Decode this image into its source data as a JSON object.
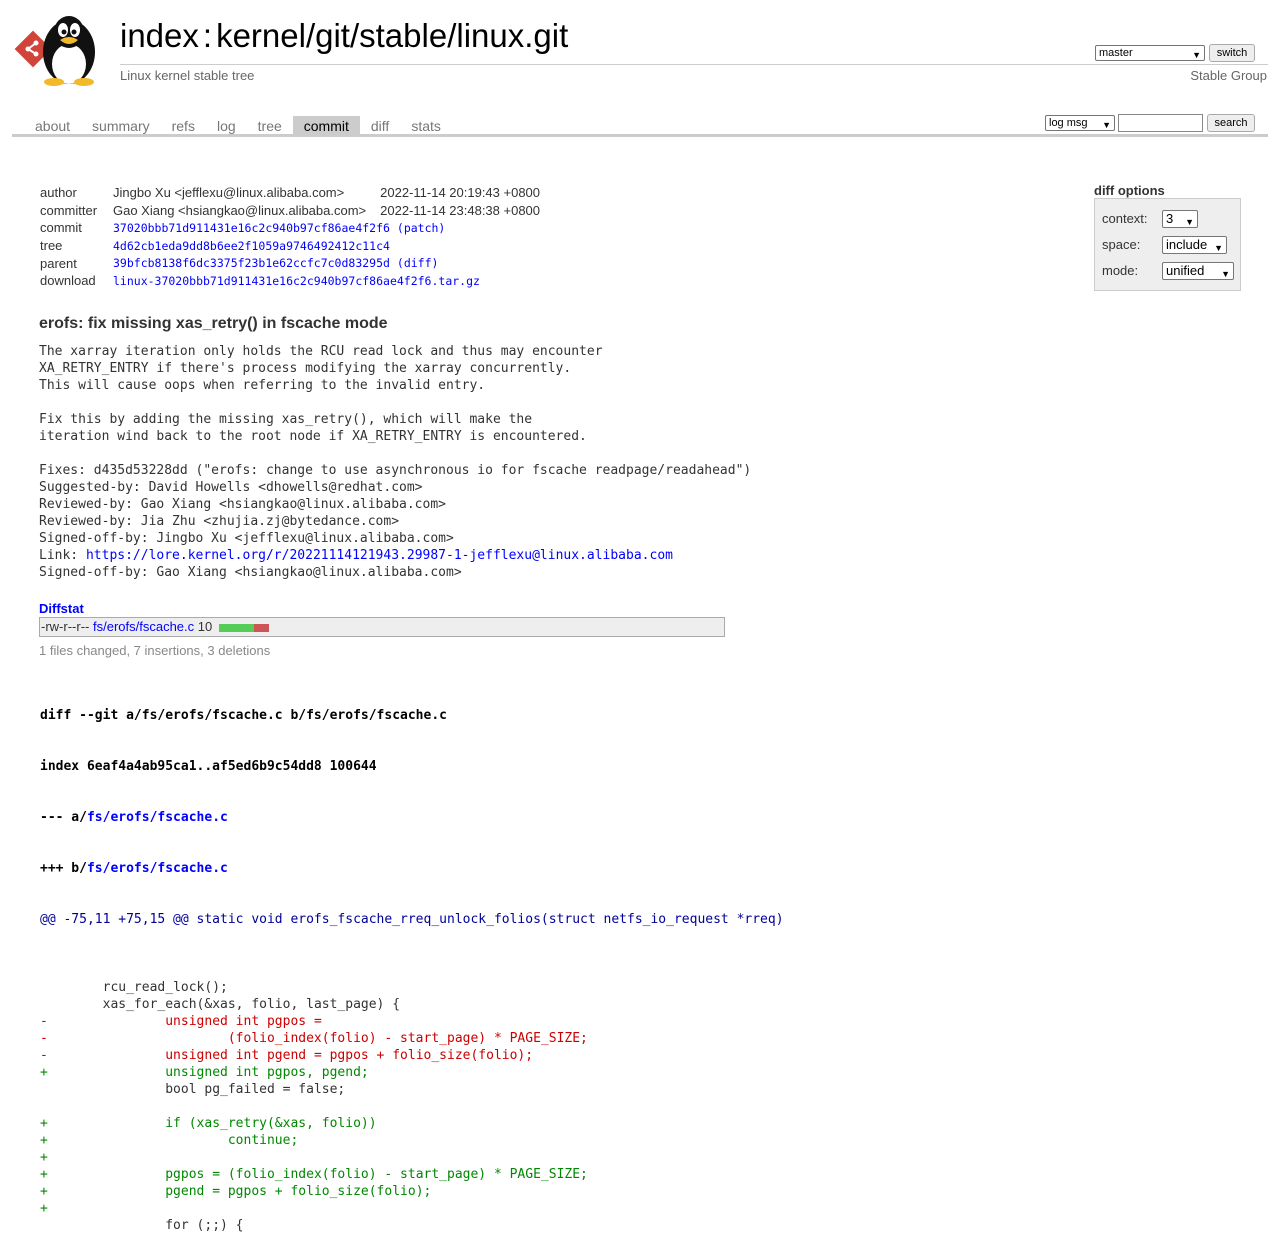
{
  "header": {
    "title_index": "index",
    "title_sep": ":",
    "title_repo": "kernel/git/stable/linux.git",
    "subtitle": "Linux kernel stable tree",
    "branch": "master",
    "switch_label": "switch",
    "owner": "Stable Group"
  },
  "tabs": [
    {
      "label": "about",
      "active": false
    },
    {
      "label": "summary",
      "active": false
    },
    {
      "label": "refs",
      "active": false
    },
    {
      "label": "log",
      "active": false
    },
    {
      "label": "tree",
      "active": false
    },
    {
      "label": "commit",
      "active": true
    },
    {
      "label": "diff",
      "active": false
    },
    {
      "label": "stats",
      "active": false
    }
  ],
  "search": {
    "type": "log msg",
    "value": "",
    "button": "search"
  },
  "diff_options": {
    "title": "diff options",
    "context_label": "context:",
    "context_value": "3",
    "space_label": "space:",
    "space_value": "include",
    "mode_label": "mode:",
    "mode_value": "unified"
  },
  "commit": {
    "author_label": "author",
    "author": "Jingbo Xu <jefflexu@linux.alibaba.com>",
    "author_date": "2022-11-14 20:19:43 +0800",
    "committer_label": "committer",
    "committer": "Gao Xiang <hsiangkao@linux.alibaba.com>",
    "committer_date": "2022-11-14 23:48:38 +0800",
    "commit_label": "commit",
    "commit_hash": "37020bbb71d911431e16c2c940b97cf86ae4f2f6",
    "patch_link": "(patch)",
    "tree_label": "tree",
    "tree_hash": "4d62cb1eda9dd8b6ee2f1059a9746492412c11c4",
    "parent_label": "parent",
    "parent_hash": "39bfcb8138f6dc3375f23b1e62ccfc7c0d83295d",
    "diff_link": "(diff)",
    "download_label": "download",
    "download_file": "linux-37020bbb71d911431e16c2c940b97cf86ae4f2f6.tar.gz"
  },
  "message": {
    "subject": "erofs: fix missing xas_retry() in fscache mode",
    "body": "The xarray iteration only holds the RCU read lock and thus may encounter\nXA_RETRY_ENTRY if there's process modifying the xarray concurrently.\nThis will cause oops when referring to the invalid entry.\n\nFix this by adding the missing xas_retry(), which will make the\niteration wind back to the root node if XA_RETRY_ENTRY is encountered.\n\nFixes: d435d53228dd (\"erofs: change to use asynchronous io for fscache readpage/readahead\")\nSuggested-by: David Howells <dhowells@redhat.com>\nReviewed-by: Gao Xiang <hsiangkao@linux.alibaba.com>\nReviewed-by: Jia Zhu <zhujia.zj@bytedance.com>\nSigned-off-by: Jingbo Xu <jefflexu@linux.alibaba.com>\n",
    "link_prefix": "Link: ",
    "link_url": "https://lore.kernel.org/r/20221114121943.29987-1-jefflexu@linux.alibaba.com",
    "tail": "\nSigned-off-by: Gao Xiang <hsiangkao@linux.alibaba.com>"
  },
  "diffstat": {
    "title": "Diffstat",
    "mode": "-rw-r--r--",
    "file": "fs/erofs/fscache.c",
    "count": "10",
    "insert_fraction": 0.7,
    "summary": "1 files changed, 7 insertions, 3 deletions"
  },
  "diff": {
    "git_line": "diff --git a/fs/erofs/fscache.c b/fs/erofs/fscache.c",
    "index_line": "index 6eaf4a4ab95ca1..af5ed6b9c54dd8 100644",
    "minus_prefix": "--- a/",
    "plus_prefix": "+++ b/",
    "file": "fs/erofs/fscache.c",
    "hunk": "@@ -75,11 +75,15 @@ static void erofs_fscache_rreq_unlock_folios(struct netfs_io_request *rreq)",
    "lines": [
      {
        "t": "ctx",
        "text": " "
      },
      {
        "t": "ctx",
        "text": " \trcu_read_lock();"
      },
      {
        "t": "ctx",
        "text": " \txas_for_each(&xas, folio, last_page) {"
      },
      {
        "t": "del",
        "text": "-\t\tunsigned int pgpos ="
      },
      {
        "t": "del",
        "text": "-\t\t\t(folio_index(folio) - start_page) * PAGE_SIZE;"
      },
      {
        "t": "del",
        "text": "-\t\tunsigned int pgend = pgpos + folio_size(folio);"
      },
      {
        "t": "add",
        "text": "+\t\tunsigned int pgpos, pgend;"
      },
      {
        "t": "ctx",
        "text": " \t\tbool pg_failed = false;"
      },
      {
        "t": "ctx",
        "text": " "
      },
      {
        "t": "add",
        "text": "+\t\tif (xas_retry(&xas, folio))"
      },
      {
        "t": "add",
        "text": "+\t\t\tcontinue;"
      },
      {
        "t": "add",
        "text": "+"
      },
      {
        "t": "add",
        "text": "+\t\tpgpos = (folio_index(folio) - start_page) * PAGE_SIZE;"
      },
      {
        "t": "add",
        "text": "+\t\tpgend = pgpos + folio_size(folio);"
      },
      {
        "t": "add",
        "text": "+"
      },
      {
        "t": "ctx",
        "text": " \t\tfor (;;) {"
      }
    ]
  },
  "colors": {
    "link": "#0000ff",
    "added": "#008000",
    "removed": "#cc0000",
    "hunk": "#000099"
  }
}
